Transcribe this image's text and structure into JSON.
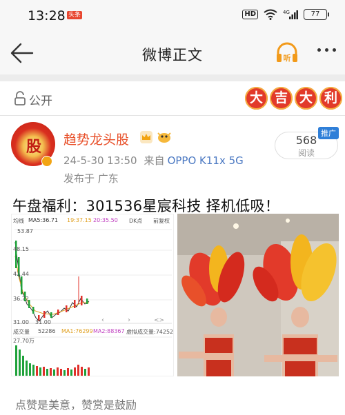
{
  "status": {
    "time": "13:28",
    "app_badge": "头条",
    "hd": "HD",
    "network": "4G",
    "battery": "77"
  },
  "header": {
    "title": "微博正文",
    "listen_label": "听"
  },
  "post": {
    "visibility": "公开",
    "badge_chars": [
      "大",
      "吉",
      "大",
      "利"
    ],
    "author": {
      "avatar_char": "股",
      "name": "趋势龙头股",
      "icons": [
        "crown-icon",
        "puffer-icon"
      ]
    },
    "date": "24-5-30 13:50",
    "source_prefix": "来自",
    "device": "OPPO K11x 5G",
    "location": "发布于 广东",
    "reads": {
      "count": "568",
      "label": "阅读",
      "tag": "推广"
    },
    "text": "午盘福利：301536星宸科技 择机低吸！"
  },
  "chart_image": {
    "labels": {
      "ma_header": "均线",
      "ma5": "MA5:36.71",
      "ma10": "19:37.15",
      "ma20": "20:35.50",
      "dk": "DK点",
      "fq": "前复权",
      "high": "53.87",
      "y1": "48.15",
      "y2": "42.44",
      "y3": "36.72",
      "low_left": "31.00",
      "low_mark": "31.00",
      "volume": "成交量",
      "vol_value": "52286",
      "ma1": "MA1:76299",
      "ma2": "MA2:88367",
      "virtual_vol": "虚拟成交量:74252",
      "vol_axis": "27.70万"
    }
  },
  "footer": {
    "text": "点赞是美意，赞赏是鼓励"
  },
  "colors": {
    "accent": "#e8502a",
    "link": "#4a78c2",
    "badge_red": "#e23a2a",
    "up": "#e0302a",
    "down": "#1fa23a"
  }
}
